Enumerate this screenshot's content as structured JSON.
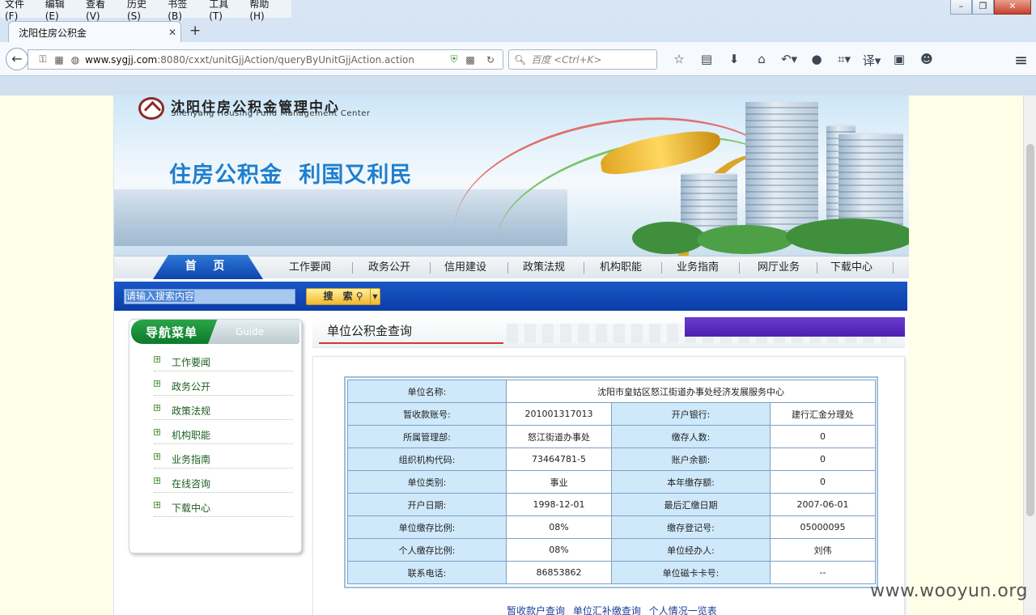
{
  "browser": {
    "menu": [
      "文件(F)",
      "编辑(E)",
      "查看(V)",
      "历史(S)",
      "书签(B)",
      "工具(T)",
      "帮助(H)"
    ],
    "tab_title": "沈阳住房公积金",
    "url_host": "www.sygjj.com",
    "url_path": ":8080/cxxt/unitGjjAction/queryByUnitGjjAction.action",
    "search_placeholder": "百度 <Ctrl+K>"
  },
  "site": {
    "logo_cn": "沈阳住房公积金管理中心",
    "logo_en": "Shenyang Housing Fund Management Center",
    "slogan": "住房公积金  利国又利民",
    "nav": {
      "home": "首 页",
      "items": [
        "工作要闻",
        "政务公开",
        "信用建设",
        "政策法规",
        "机构职能",
        "业务指南",
        "网厅业务",
        "下载中心"
      ]
    },
    "search": {
      "placeholder": "请输入搜索内容",
      "button": "搜 索"
    }
  },
  "sidebar": {
    "title_cn": "导航菜单",
    "title_en": "Guide",
    "items": [
      "工作要闻",
      "政务公开",
      "政策法规",
      "机构职能",
      "业务指南",
      "在线咨询",
      "下载中心"
    ]
  },
  "content": {
    "title": "单位公积金查询",
    "unit_name_label": "单位名称:",
    "unit_name": "沈阳市皇姑区怒江街道办事处经济发展服务中心",
    "rows": [
      [
        "暂收款账号:",
        "201001317013",
        "开户银行:",
        "建行汇金分理处"
      ],
      [
        "所属管理部:",
        "怒江街道办事处",
        "缴存人数:",
        "0"
      ],
      [
        "组织机构代码:",
        "73464781-5",
        "账户余额:",
        "0"
      ],
      [
        "单位类别:",
        "事业",
        "本年缴存额:",
        "0"
      ],
      [
        "开户日期:",
        "1998-12-01",
        "最后汇缴日期",
        "2007-06-01"
      ],
      [
        "单位缴存比例:",
        "08%",
        "缴存登记号:",
        "05000095"
      ],
      [
        "个人缴存比例:",
        "08%",
        "单位经办人:",
        "刘伟"
      ],
      [
        "联系电话:",
        "86853862",
        "单位磁卡卡号:",
        "--"
      ]
    ],
    "bottom_links": [
      "暂收款户查询",
      "单位汇补缴查询",
      "个人情况一览表"
    ]
  },
  "watermark": "www.wooyun.org"
}
